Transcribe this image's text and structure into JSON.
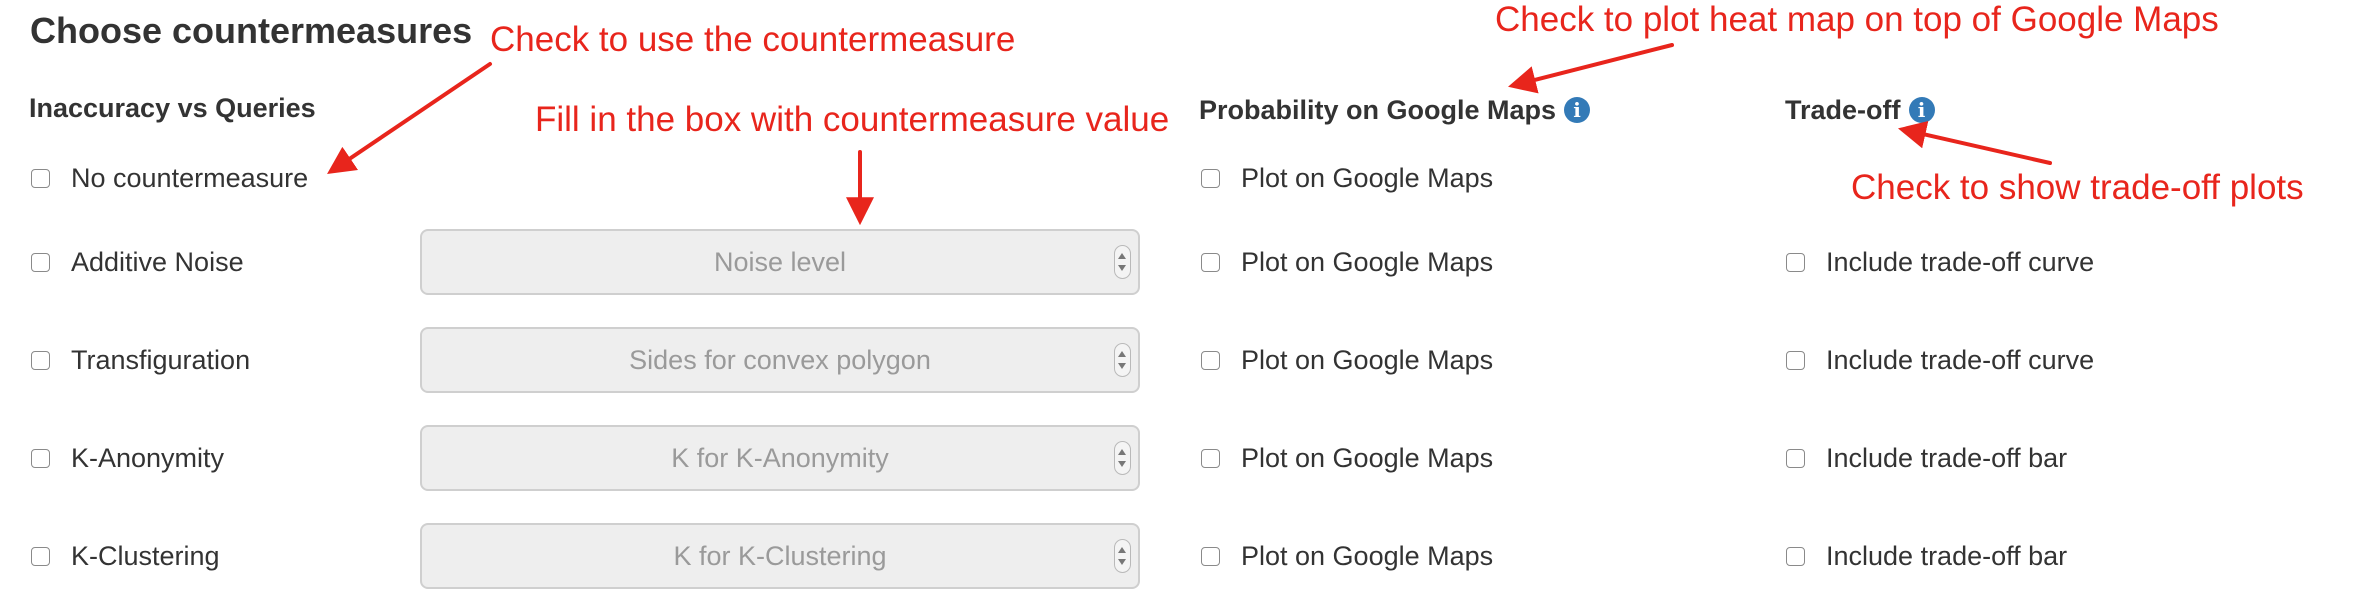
{
  "title": "Choose countermeasures",
  "columns": {
    "inaccuracy": "Inaccuracy vs Queries",
    "probability": "Probability on Google Maps",
    "tradeoff": "Trade-off"
  },
  "info_icon_glyph": "i",
  "accent_color": "#337ab7",
  "annotation_color": "#e8251c",
  "rows": [
    {
      "countermeasure": "No countermeasure",
      "input_placeholder": "",
      "plot": "Plot on Google Maps",
      "tradeoff": ""
    },
    {
      "countermeasure": "Additive Noise",
      "input_placeholder": "Noise level",
      "plot": "Plot on Google Maps",
      "tradeoff": "Include trade-off curve"
    },
    {
      "countermeasure": "Transfiguration",
      "input_placeholder": "Sides for convex polygon",
      "plot": "Plot on Google Maps",
      "tradeoff": "Include trade-off curve"
    },
    {
      "countermeasure": "K-Anonymity",
      "input_placeholder": "K for K-Anonymity",
      "plot": "Plot on Google Maps",
      "tradeoff": "Include trade-off bar"
    },
    {
      "countermeasure": "K-Clustering",
      "input_placeholder": "K for K-Clustering",
      "plot": "Plot on Google Maps",
      "tradeoff": "Include trade-off bar"
    }
  ],
  "annotations": {
    "use_countermeasure": "Check to use the countermeasure",
    "fill_box": "Fill in the box with countermeasure value",
    "heat_map": "Check to plot heat map on top of Google Maps",
    "tradeoff_plots": "Check to show trade-off plots"
  }
}
